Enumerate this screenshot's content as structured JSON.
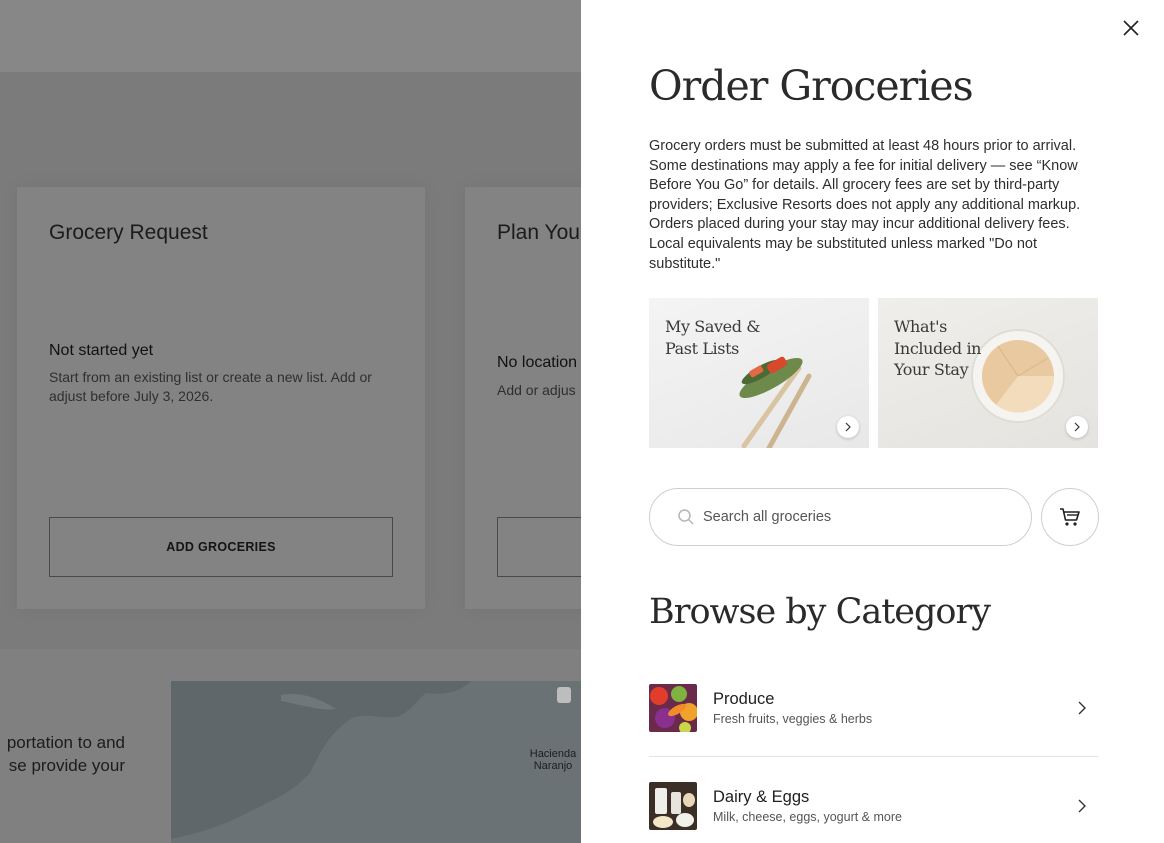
{
  "background": {
    "cards": [
      {
        "title": "Grocery Request",
        "status": "Not started yet",
        "description": "Start from an existing list or create a new list. Add or adjust before July 3, 2026.",
        "button_label": "ADD GROCERIES"
      },
      {
        "title": "Plan You",
        "status": "No location",
        "description": "Add or adjus",
        "button_label": ""
      }
    ],
    "transport_text": "portation to and se provide your",
    "map_label": "Hacienda Naranjo"
  },
  "drawer": {
    "title": "Order Groceries",
    "intro": "Grocery orders must be submitted at least 48 hours prior to arrival. Some destinations may apply a fee for initial delivery — see “Know Before You Go” for details. All grocery fees are set by third-party providers; Exclusive Resorts does not apply any additional markup. Orders placed during your stay may incur additional delivery fees. Local equivalents may be substituted unless marked \"Do not substitute.\"",
    "promos": [
      {
        "title": "My Saved & Past Lists",
        "icon": "chevron-right-icon"
      },
      {
        "title": "What's Included in Your Stay",
        "icon": "chevron-right-icon"
      }
    ],
    "search": {
      "placeholder": "Search all groceries",
      "value": ""
    },
    "cart_icon": "cart-icon",
    "browse_title": "Browse by Category",
    "categories": [
      {
        "name": "Produce",
        "description": "Fresh fruits, veggies & herbs"
      },
      {
        "name": "Dairy & Eggs",
        "description": "Milk, cheese, eggs, yogurt & more"
      }
    ]
  },
  "colors": {
    "overlay": "#808080",
    "drawer_bg": "#ffffff",
    "text": "#2a2a2a"
  }
}
